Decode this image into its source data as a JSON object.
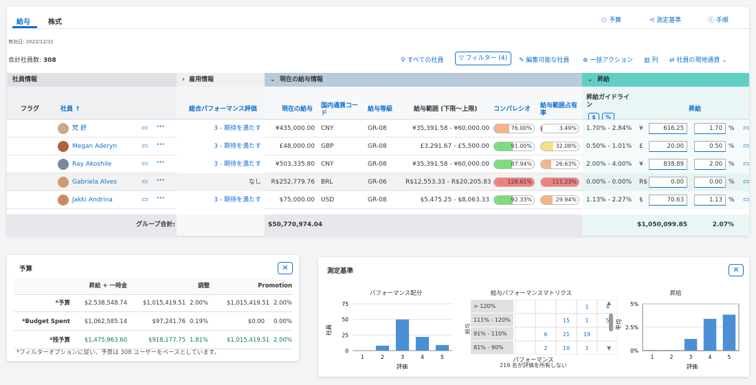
{
  "tabs": [
    "給与",
    "株式"
  ],
  "top_tools": [
    "予算",
    "測定基準",
    "手順"
  ],
  "effective_date": "有効日: 2022/12/31",
  "total_employees_label": "合計社員数:",
  "total_employees_value": "308",
  "toolbar": {
    "all_employees": "すべての社員",
    "filter": "フィルター (4)",
    "editable_employees": "編集可能な社員",
    "bulk_action": "一括アクション",
    "columns": "列",
    "local_currency": "社員の現地通貨"
  },
  "group_headers": {
    "employee_info": "社員情報",
    "employment_info": "雇用情報",
    "current_salary_info": "現在の給与情報",
    "raise": "昇給"
  },
  "columns": {
    "flag": "フラグ",
    "employee": "社員",
    "overall_performance": "総合パフォーマンス評価",
    "current_salary": "現在の給与",
    "currency_code": "国内通貨コード",
    "salary_grade": "給与等級",
    "salary_range": "給与範囲 (下限〜上限)",
    "compa_ratio": "コンパレシオ",
    "range_penetration": "給与範囲占有率",
    "raise_guideline": "昇給ガイドライン",
    "guideline_dollar": "$",
    "guideline_pct": "%",
    "raise": "昇給"
  },
  "rows": [
    {
      "name": "梵 舒",
      "rating": "3 - 期待を満たす",
      "salary": "¥435,000.00",
      "currency": "CNY",
      "grade": "GR-08",
      "range": "¥35,391.58 - ¥60,000.00",
      "compa": "76.00%",
      "compa_v": 0.38,
      "compa_color": "#f5b58a",
      "pen": "3.49%",
      "pen_v": 0.035,
      "pen_color": "#e3565e",
      "guideline": "1.70% - 2.84%",
      "sym": "¥",
      "raise_amt": "616.25",
      "raise_pct": "1.70"
    },
    {
      "name": "Megan Aderyn",
      "rating": "3 - 期待を満たす",
      "salary": "£48,000.00",
      "currency": "GBP",
      "grade": "GR-08",
      "range": "£3,291.67 - £5,500.00",
      "compa": "91.00%",
      "compa_v": 0.46,
      "compa_color": "#7edc7e",
      "pen": "32.08%",
      "pen_v": 0.32,
      "pen_color": "#f5e08a",
      "guideline": "0.50% - 1.01%",
      "sym": "£",
      "raise_amt": "20.00",
      "raise_pct": "0.50"
    },
    {
      "name": "Ray Akoshile",
      "rating": "3 - 期待を満たす",
      "salary": "¥503,335.80",
      "currency": "CNY",
      "grade": "GR-08",
      "range": "¥35,391.58 - ¥60,000.00",
      "compa": "87.94%",
      "compa_v": 0.44,
      "compa_color": "#7edc7e",
      "pen": "26.63%",
      "pen_v": 0.27,
      "pen_color": "#f5b58a",
      "guideline": "2.00% - 4.00%",
      "sym": "¥",
      "raise_amt": "838.89",
      "raise_pct": "2.00"
    },
    {
      "name": "Gabriela Alves",
      "rating": "なし",
      "salary": "R$252,779.76",
      "currency": "BRL",
      "grade": "GR-06",
      "range": "R$12,553.33 - R$20,205.83",
      "compa": "128.61%",
      "compa_v": 1.0,
      "compa_color": "#f08080",
      "pen": "111.23%",
      "pen_v": 1.0,
      "pen_color": "#f08080",
      "guideline": "0.00% - 0.00%",
      "sym": "R$",
      "raise_amt": "0.00",
      "raise_pct": "0.00"
    },
    {
      "name": "Jakki Andrina",
      "rating": "3 - 期待を満たす",
      "salary": "$75,000.00",
      "currency": "USD",
      "grade": "GR-08",
      "range": "$5,475.25 - $8,063.33",
      "compa": "92.33%",
      "compa_v": 0.47,
      "compa_color": "#7edc7e",
      "pen": "29.94%",
      "pen_v": 0.3,
      "pen_color": "#f5b58a",
      "guideline": "1.13% - 2.27%",
      "sym": "$",
      "raise_amt": "70.63",
      "raise_pct": "1.13"
    }
  ],
  "footer": {
    "label": "グループ合計:",
    "salary_total": "$50,770,974.04",
    "raise_total": "$1,050,099.85",
    "raise_pct_total": "2.07%"
  },
  "budget": {
    "title": "予算",
    "headers": [
      "昇給 + 一時金",
      "調整",
      "Promotion"
    ],
    "rows": [
      {
        "label": "*予算",
        "v": [
          "$2,538,548.74",
          "$1,015,419.51",
          "2.00%",
          "$1,015,419.51",
          "2.00%"
        ]
      },
      {
        "label": "*Budget Spent",
        "v": [
          "$1,062,585.14",
          "$97,241.76",
          "0.19%",
          "$0.00",
          "0.00%"
        ]
      },
      {
        "label": "*残予算",
        "v": [
          "$1,475,963.60",
          "$918,177.75",
          "1.81%",
          "$1,015,419.51",
          "2.00%"
        ]
      }
    ],
    "note": "*フィルターオプションに従い、予算は 308 ユーザーをベースとしています。"
  },
  "metrics": {
    "title": "測定基準",
    "perf_chart_title": "パフォーマンス配分",
    "perf_ylabel": "社員",
    "perf_xlabel": "評価",
    "matrix_title": "給与パフォーマンスマトリクス",
    "matrix_ylabel": "給与",
    "matrix_xlabel": "パフォーマンス",
    "matrix_note": "219 名が評価を所有しない",
    "raise_chart_title": "昇給",
    "raise_ylabel": "平均",
    "raise_xlabel": "評価",
    "matrix_rows": [
      {
        "label": "> 120%",
        "cells": [
          "",
          "",
          "",
          "1",
          "4"
        ]
      },
      {
        "label": "111% - 120%",
        "cells": [
          "",
          "",
          "15",
          "1",
          "5"
        ]
      },
      {
        "label": "91% - 110%",
        "cells": [
          "",
          "6",
          "21",
          "19",
          ""
        ]
      },
      {
        "label": "81% - 90%",
        "cells": [
          "",
          "2",
          "10",
          "1",
          ""
        ]
      }
    ]
  },
  "chart_data": [
    {
      "type": "bar",
      "title": "パフォーマンス配分",
      "xlabel": "評価",
      "ylabel": "社員",
      "categories": [
        "1",
        "2",
        "3",
        "4",
        "5"
      ],
      "values": [
        0,
        8,
        50,
        22,
        9
      ],
      "ylim": [
        0,
        75
      ],
      "yticks": [
        "0",
        "25",
        "50",
        "75"
      ]
    },
    {
      "type": "bar",
      "title": "昇給",
      "xlabel": "評価",
      "ylabel": "平均",
      "categories": [
        "1",
        "2",
        "3",
        "4",
        "5"
      ],
      "values": [
        0.05,
        0.05,
        1.25,
        3.4,
        3.85
      ],
      "ylim": [
        0,
        5
      ],
      "yticks": [
        "0%",
        "2.5%",
        "5%"
      ]
    }
  ]
}
